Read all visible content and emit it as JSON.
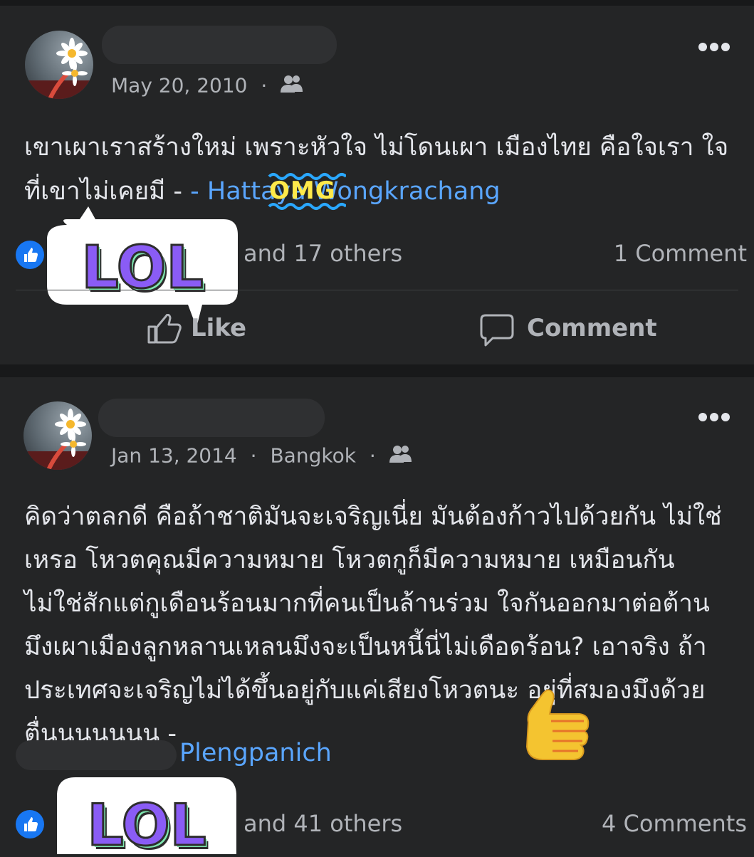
{
  "posts": [
    {
      "date": "May 20, 2010",
      "location": "",
      "text_main": "เขาเผาเราสร้างใหม่ เพราะหัวใจ ไม่โดนเผา เมืองไทย คือใจเรา ใจที่เขาไม่เคยมี -",
      "text_author": "- Hattaya Wongkrachang",
      "reactions": "and 17 others",
      "comments": "1 Comment",
      "like_label": "Like",
      "comment_label": "Comment"
    },
    {
      "date": "Jan 13, 2014",
      "location": "Bangkok",
      "text_main": "คิดว่าตลกดี คือถ้าชาติมันจะเจริญเนี่ย มันต้องก้าวไปด้วยกัน ไม่ใช่เหรอ โหวตคุณมีความหมาย โหวตกูก็มีความหมาย เหมือนกัน ไม่ใช่สักแต่กูเดือนร้อนมากที่คนเป็นล้านร่วม ใจกันออกมาต่อต้าน มึงเผาเมืองลูกหลานเหลนมึงจะเป็นหนี้นี่ไม่เดือดร้อน? เอาจริง ถ้าประเทศจะเจริญไม่ได้ขึ้นอยู่กับแค่เสียงโหวตนะ อยู่ที่สมองมึงด้วย ตื่นนนนนนน  -",
      "text_author": "Plengpanich",
      "reactions": "and 41 others",
      "comments": "4 Comments"
    }
  ],
  "stickers": {
    "lol_text": "LOL",
    "omg_text": "OMG"
  },
  "colors": {
    "background": "#242526",
    "link": "#5aa6ff",
    "like_blue": "#1877f2",
    "lol_purple": "#8a5cf5",
    "lol_green": "#7ee8b0"
  },
  "icons": [
    "more-icon",
    "friends-icon",
    "like-reaction-icon",
    "thumbs-up-icon",
    "comment-bubble-icon",
    "thumbs-up-emoji"
  ]
}
